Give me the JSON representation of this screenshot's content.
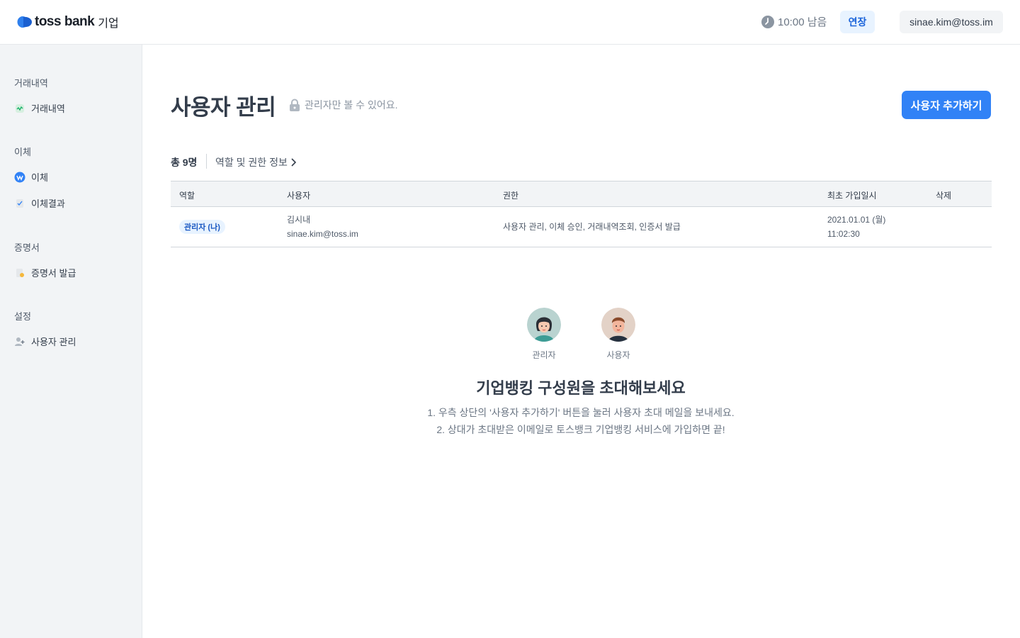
{
  "header": {
    "logo_text": "toss bank",
    "logo_sub": "기업",
    "timer": "10:00 남음",
    "extend_label": "연장",
    "account": "sinae.kim@toss.im"
  },
  "sidebar": {
    "sections": [
      {
        "title": "거래내역",
        "items": [
          {
            "label": "거래내역",
            "icon": "transactions-icon"
          }
        ]
      },
      {
        "title": "이체",
        "items": [
          {
            "label": "이체",
            "icon": "transfer-icon"
          },
          {
            "label": "이체결과",
            "icon": "transfer-result-icon"
          }
        ]
      },
      {
        "title": "증명서",
        "items": [
          {
            "label": "증명서 발급",
            "icon": "certificate-icon"
          }
        ]
      },
      {
        "title": "설정",
        "items": [
          {
            "label": "사용자 관리",
            "icon": "user-add-icon"
          }
        ]
      }
    ]
  },
  "main": {
    "title": "사용자 관리",
    "admin_notice": "관리자만 볼 수 있어요.",
    "add_button": "사용자 추가하기",
    "total": "총 9명",
    "role_link": "역할 및 권한 정보"
  },
  "table": {
    "columns": [
      "역할",
      "사용자",
      "권한",
      "최초 가입일시",
      "삭제"
    ],
    "rows": [
      {
        "role": "관리자 (나)",
        "name": "김시내",
        "email": "sinae.kim@toss.im",
        "permissions": "사용자 관리, 이체 승인, 거래내역조회, 인증서 발급",
        "date": "2021.01.01 (월)",
        "time": "11:02:30"
      }
    ]
  },
  "empty_state": {
    "admin_label": "관리자",
    "user_label": "사용자",
    "title": "기업뱅킹 구성원을 초대해보세요",
    "line1": "1. 우측 상단의 '사용자 추가하기' 버튼을 눌러 사용자 초대 메일을 보내세요.",
    "line2": "2. 상대가 초대받은 이메일로 토스뱅크 기업뱅킹 서비스에 가입하면 끝!"
  },
  "colors": {
    "primary": "#3182f6",
    "sidebar_bg": "#f2f4f6",
    "badge_bg": "#e8f3ff"
  }
}
